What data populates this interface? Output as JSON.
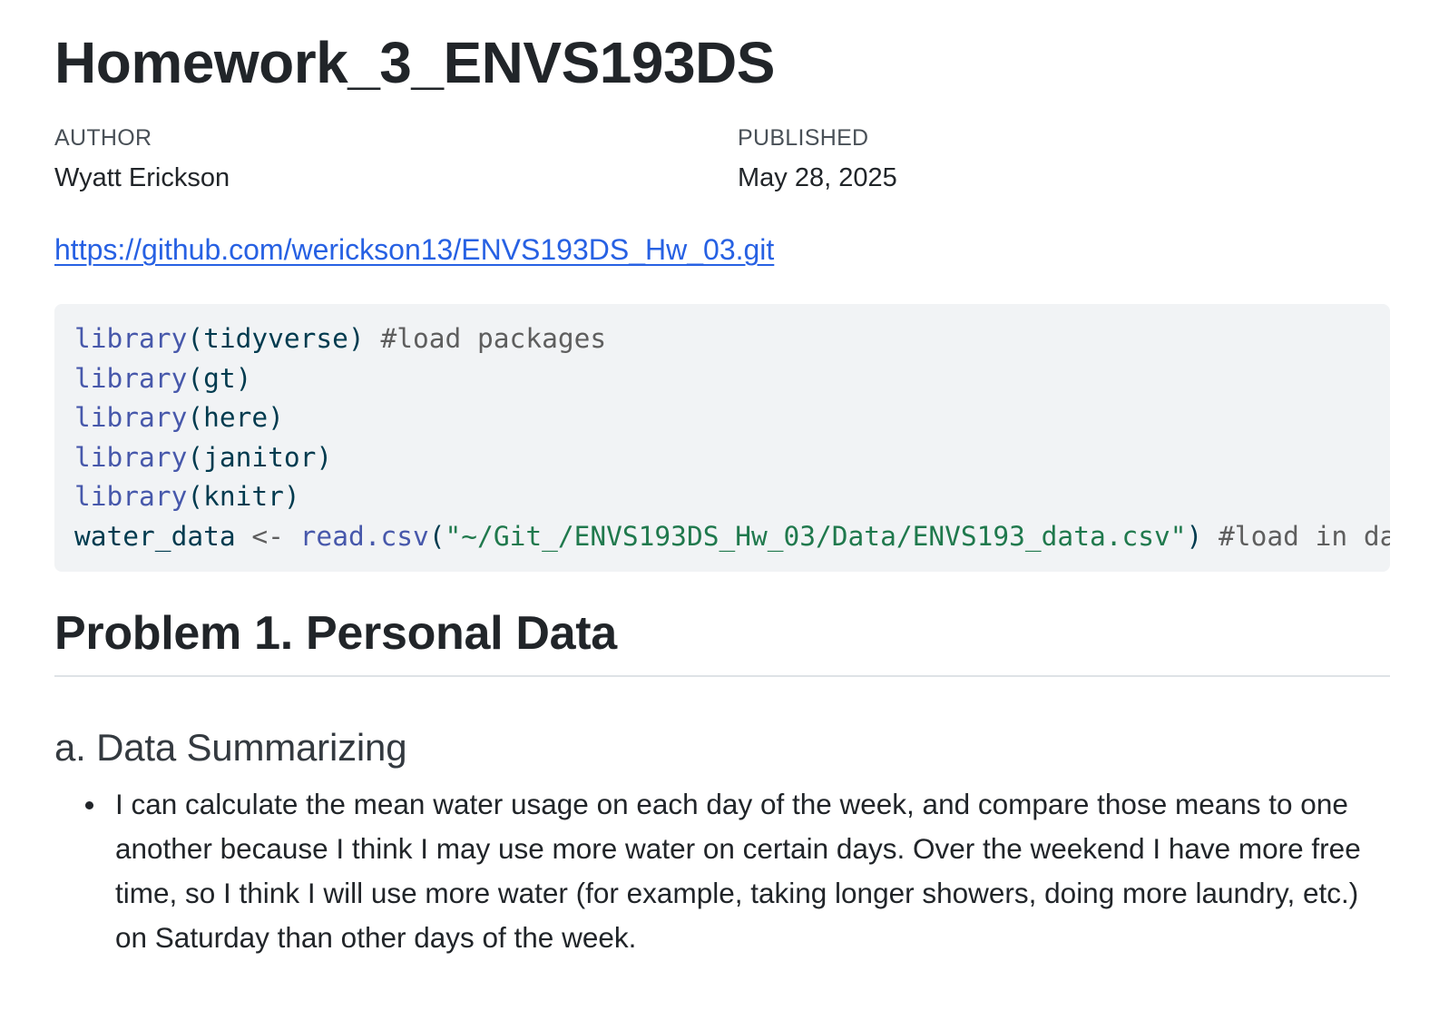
{
  "document": {
    "title": "Homework_3_ENVS193DS",
    "meta": {
      "author_heading": "AUTHOR",
      "author": "Wyatt Erickson",
      "published_heading": "PUBLISHED",
      "published": "May 28, 2025"
    },
    "repo_link": "https://github.com/werickson13/ENVS193DS_Hw_03.git"
  },
  "code": {
    "lines": [
      [
        {
          "cls": "fn",
          "text": "library"
        },
        {
          "cls": "plain",
          "text": "(tidyverse) "
        },
        {
          "cls": "cmt",
          "text": "#load packages"
        }
      ],
      [
        {
          "cls": "fn",
          "text": "library"
        },
        {
          "cls": "plain",
          "text": "(gt)"
        }
      ],
      [
        {
          "cls": "fn",
          "text": "library"
        },
        {
          "cls": "plain",
          "text": "(here)"
        }
      ],
      [
        {
          "cls": "fn",
          "text": "library"
        },
        {
          "cls": "plain",
          "text": "(janitor)"
        }
      ],
      [
        {
          "cls": "fn",
          "text": "library"
        },
        {
          "cls": "plain",
          "text": "(knitr)"
        }
      ],
      [
        {
          "cls": "plain",
          "text": "water_data "
        },
        {
          "cls": "op",
          "text": "<-"
        },
        {
          "cls": "plain",
          "text": " "
        },
        {
          "cls": "fn",
          "text": "read.csv"
        },
        {
          "cls": "plain",
          "text": "("
        },
        {
          "cls": "str",
          "text": "\"~/Git_/ENVS193DS_Hw_03/Data/ENVS193_data.csv\""
        },
        {
          "cls": "plain",
          "text": ") "
        },
        {
          "cls": "cmt",
          "text": "#load in da"
        }
      ]
    ]
  },
  "section": {
    "h2": "Problem 1. Personal Data",
    "h3": "a. Data Summarizing",
    "bullets": [
      "I can calculate the mean water usage on each day of the week, and compare those means to one another because I think I may use more water on certain days. Over the weekend I have more free time, so I think I will use more water (for example, taking longer showers, doing more laundry, etc.) on Saturday than other days of the week."
    ]
  },
  "colors": {
    "link": "#2761e3",
    "code_bg": "#f1f3f5",
    "code_function": "#4758ab",
    "code_string": "#20794d",
    "code_comment": "#5e5e5e",
    "text": "#212529"
  }
}
